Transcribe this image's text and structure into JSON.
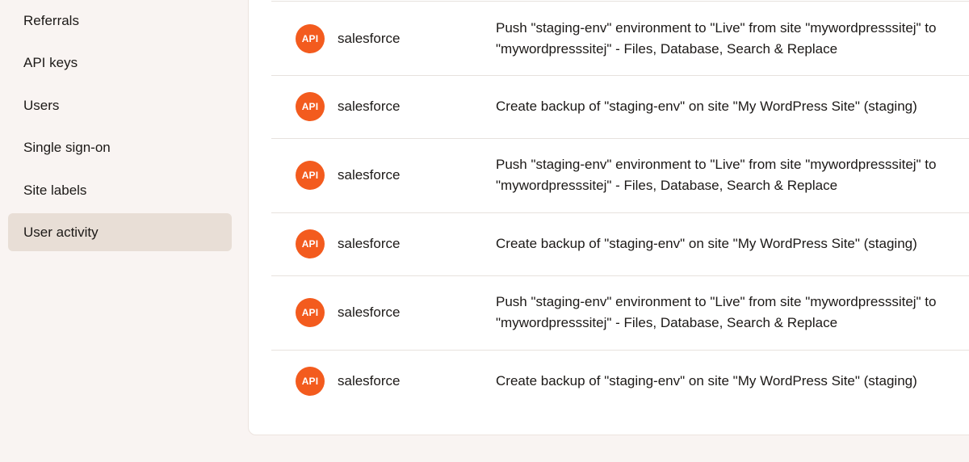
{
  "sidebar": {
    "items": [
      {
        "label": "Referrals"
      },
      {
        "label": "API keys"
      },
      {
        "label": "Users"
      },
      {
        "label": "Single sign-on"
      },
      {
        "label": "Site labels"
      },
      {
        "label": "User activity",
        "active": true
      }
    ]
  },
  "activity": {
    "badge_label": "API",
    "badge_color": "#f35b1e",
    "rows": [
      {
        "actor": "salesforce",
        "description": "Push \"staging-env\" environment to \"Live\" from site \"mywordpresssitej\" to\n\"mywordpresssitej\" - Files, Database, Search & Replace"
      },
      {
        "actor": "salesforce",
        "description": "Create backup of \"staging-env\" on site \"My WordPress Site\" (staging)"
      },
      {
        "actor": "salesforce",
        "description": "Push \"staging-env\" environment to \"Live\" from site \"mywordpresssitej\" to\n\"mywordpresssitej\" - Files, Database, Search & Replace"
      },
      {
        "actor": "salesforce",
        "description": "Create backup of \"staging-env\" on site \"My WordPress Site\" (staging)"
      },
      {
        "actor": "salesforce",
        "description": "Push \"staging-env\" environment to \"Live\" from site \"mywordpresssitej\" to\n\"mywordpresssitej\" - Files, Database, Search & Replace"
      },
      {
        "actor": "salesforce",
        "description": "Create backup of \"staging-env\" on site \"My WordPress Site\" (staging)"
      }
    ]
  }
}
